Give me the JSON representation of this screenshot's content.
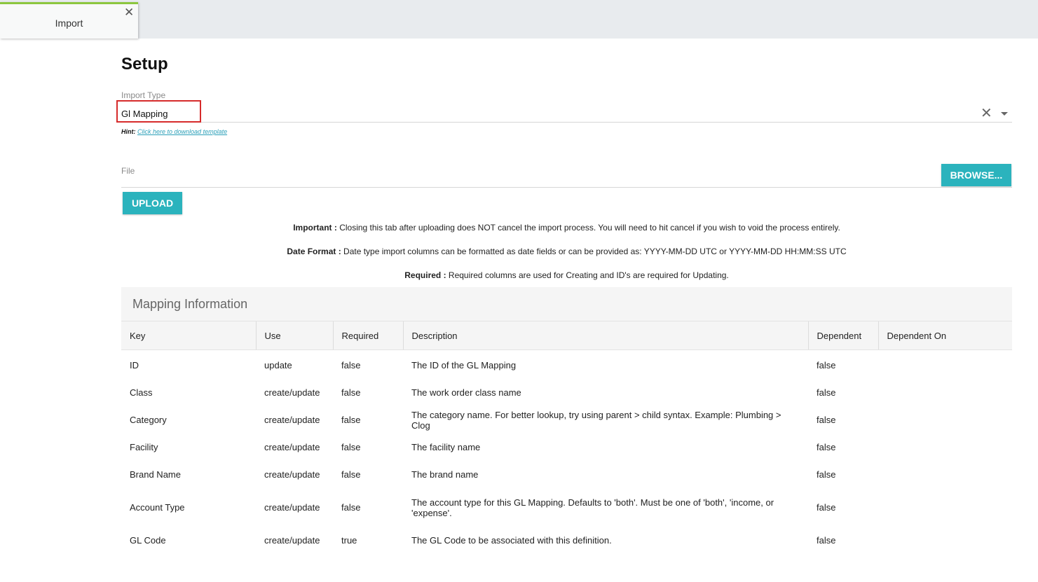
{
  "tab": {
    "label": "Import",
    "close_symbol": "✕"
  },
  "page": {
    "title": "Setup"
  },
  "import_type": {
    "label": "Import Type",
    "value": "Gl Mapping",
    "clear_symbol": "✕",
    "hint_label": "Hint:",
    "hint_link": "Click here to download template"
  },
  "file": {
    "label": "File",
    "browse_label": "BROWSE...",
    "upload_label": "UPLOAD"
  },
  "notes": [
    {
      "bold": "Important :",
      "text": " Closing this tab after uploading does NOT cancel the import process. You will need to hit cancel if you wish to void the process entirely."
    },
    {
      "bold": "Date Format :",
      "text": " Date type import columns can be formatted as date fields or can be provided as: YYYY-MM-DD UTC or YYYY-MM-DD HH:MM:SS UTC"
    },
    {
      "bold": "Required :",
      "text": " Required columns are used for Creating and ID's are required for Updating."
    }
  ],
  "mapping": {
    "title": "Mapping Information",
    "headers": [
      "Key",
      "Use",
      "Required",
      "Description",
      "Dependent",
      "Dependent On"
    ],
    "rows": [
      [
        "ID",
        "update",
        "false",
        "The ID of the GL Mapping",
        "false",
        ""
      ],
      [
        "Class",
        "create/update",
        "false",
        "The work order class name",
        "false",
        ""
      ],
      [
        "Category",
        "create/update",
        "false",
        "The category name. For better lookup, try using parent > child syntax. Example: Plumbing > Clog",
        "false",
        ""
      ],
      [
        "Facility",
        "create/update",
        "false",
        "The facility name",
        "false",
        ""
      ],
      [
        "Brand Name",
        "create/update",
        "false",
        "The brand name",
        "false",
        ""
      ],
      [
        "Account Type",
        "create/update",
        "false",
        "The account type for this GL Mapping. Defaults to 'both'. Must be one of 'both', 'income, or 'expense'.",
        "false",
        ""
      ],
      [
        "GL Code",
        "create/update",
        "true",
        "The GL Code to be associated with this definition.",
        "false",
        ""
      ]
    ]
  },
  "colors": {
    "accent": "#2bb3bd",
    "tab_accent": "#8cc63f",
    "highlight": "#d62b2b"
  }
}
